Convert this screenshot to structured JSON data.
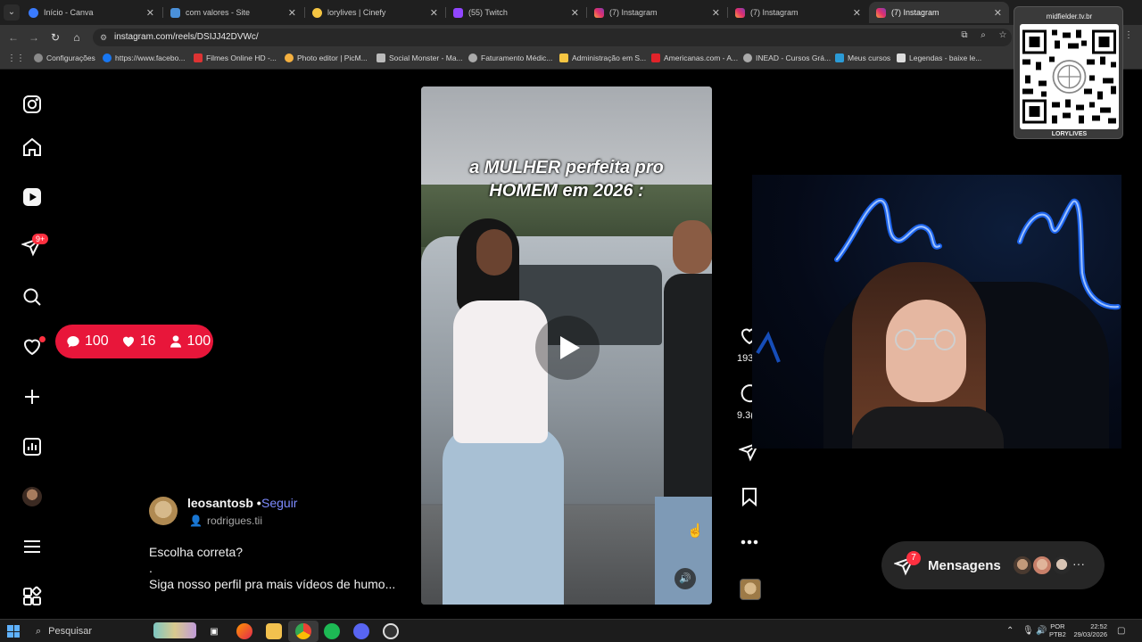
{
  "browser": {
    "tabs": [
      {
        "title": "Início - Canva",
        "favicon_color": "#3a7bff"
      },
      {
        "title": "com valores - Site",
        "favicon_color": "#4a90d9"
      },
      {
        "title": "lorylives | Cinefy",
        "favicon_color": "#f5c542"
      },
      {
        "title": "(55) Twitch",
        "favicon_color": "#9146ff"
      },
      {
        "title": "(7) Instagram",
        "favicon_color": "#e1306c"
      },
      {
        "title": "(7) Instagram",
        "favicon_color": "#e1306c"
      },
      {
        "title": "(7) Instagram",
        "favicon_color": "#e1306c",
        "active": true
      }
    ],
    "url": "instagram.com/reels/DSIJJ42DVWc/",
    "bookmarks": [
      {
        "label": "Configurações",
        "icon": "gear-icon",
        "color": "#9a9a9a"
      },
      {
        "label": "https://www.facebo...",
        "icon": "facebook-icon",
        "color": "#1877f2"
      },
      {
        "label": "Filmes Online HD -...",
        "icon": "film-icon",
        "color": "#d33"
      },
      {
        "label": "Photo editor | PicM...",
        "icon": "photo-icon",
        "color": "#f4b040"
      },
      {
        "label": "Social Monster - Ma...",
        "icon": "rocket-icon",
        "color": "#bbb"
      },
      {
        "label": "Faturamento Médic...",
        "icon": "globe-icon",
        "color": "#bbb"
      },
      {
        "label": "Administração em S...",
        "icon": "pen-icon",
        "color": "#f5c542"
      },
      {
        "label": "Americanas.com - A...",
        "icon": "store-icon",
        "color": "#e0232a"
      },
      {
        "label": "INEAD - Cursos Grá...",
        "icon": "globe-icon",
        "color": "#bbb"
      },
      {
        "label": "Meus cursos",
        "icon": "course-icon",
        "color": "#2b9bd6"
      },
      {
        "label": "Legendas - baixe le...",
        "icon": "subtitle-icon",
        "color": "#ddd"
      }
    ]
  },
  "counter_pill": {
    "comments": "100",
    "likes": "16",
    "followers": "100",
    "color": "#e8163a"
  },
  "rail": {
    "notification_badge": "9+"
  },
  "post": {
    "username": "leosantosb",
    "separator": "•",
    "follow_label": "Seguir",
    "audio": "rodrigues.tii",
    "caption_line1": "Escolha correta?",
    "caption_line2": ".",
    "caption_line3": "Siga nosso perfil pra mais vídeos de humo..."
  },
  "reel": {
    "overlay_text_line1": "a MULHER perfeita pro",
    "overlay_text_line2": "HOMEM em 2026 :"
  },
  "actions": {
    "likes": "193",
    "comments": "9.3("
  },
  "qr": {
    "top_text": "midfielder.tv.br",
    "bottom_text": "LORYLIVES"
  },
  "messages": {
    "label": "Mensagens",
    "badge": "7",
    "more": "···"
  },
  "taskbar": {
    "search_placeholder": "Pesquisar",
    "lang_line1": "POR",
    "lang_line2": "PTB2",
    "time": "22:52",
    "date": "29/03/2026"
  }
}
